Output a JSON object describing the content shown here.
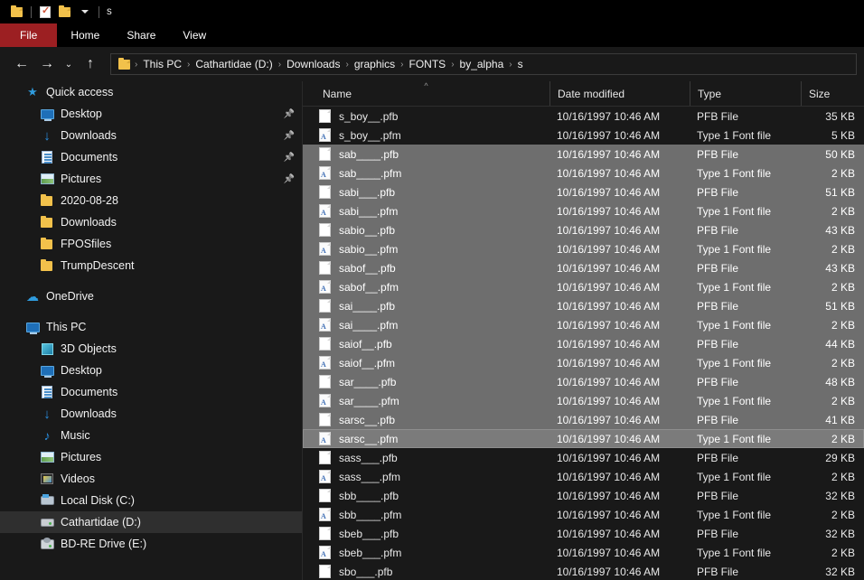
{
  "window": {
    "title": "s",
    "quick_access_toolbar": [
      {
        "name": "folder-icon",
        "label": "Explorer"
      },
      {
        "name": "properties-icon",
        "label": "Properties"
      },
      {
        "name": "new-folder-icon",
        "label": "New folder"
      },
      {
        "name": "customize-caret-icon",
        "label": "Customize Quick Access Toolbar"
      }
    ]
  },
  "ribbon": {
    "tabs": [
      {
        "label": "File",
        "active": true
      },
      {
        "label": "Home",
        "active": false
      },
      {
        "label": "Share",
        "active": false
      },
      {
        "label": "View",
        "active": false
      }
    ]
  },
  "addressbar": {
    "back_icon": "←",
    "forward_icon": "→",
    "recent_icon": "⌄",
    "up_icon": "↑",
    "separator": "›",
    "crumbs": [
      "This PC",
      "Cathartidae (D:)",
      "Downloads",
      "graphics",
      "FONTS",
      "by_alpha",
      "s"
    ]
  },
  "sidebar": {
    "items": [
      {
        "label": "Quick access",
        "icon": "star-icon",
        "indent": 0,
        "pinned": false,
        "selected": false
      },
      {
        "label": "Desktop",
        "icon": "desktop-icon",
        "indent": 1,
        "pinned": true,
        "selected": false
      },
      {
        "label": "Downloads",
        "icon": "downloads-icon",
        "indent": 1,
        "pinned": true,
        "selected": false
      },
      {
        "label": "Documents",
        "icon": "documents-icon",
        "indent": 1,
        "pinned": true,
        "selected": false
      },
      {
        "label": "Pictures",
        "icon": "pictures-icon",
        "indent": 1,
        "pinned": true,
        "selected": false
      },
      {
        "label": "2020-08-28",
        "icon": "folder-icon",
        "indent": 1,
        "pinned": false,
        "selected": false
      },
      {
        "label": "Downloads",
        "icon": "folder-icon",
        "indent": 1,
        "pinned": false,
        "selected": false
      },
      {
        "label": "FPOSfiles",
        "icon": "folder-icon",
        "indent": 1,
        "pinned": false,
        "selected": false
      },
      {
        "label": "TrumpDescent",
        "icon": "folder-icon",
        "indent": 1,
        "pinned": false,
        "selected": false
      },
      {
        "label": "OneDrive",
        "icon": "cloud-icon",
        "indent": 0,
        "pinned": false,
        "selected": false,
        "gap_before": true
      },
      {
        "label": "This PC",
        "icon": "pc-icon",
        "indent": 0,
        "pinned": false,
        "selected": false,
        "gap_before": true
      },
      {
        "label": "3D Objects",
        "icon": "3d-objects-icon",
        "indent": 1,
        "pinned": false,
        "selected": false
      },
      {
        "label": "Desktop",
        "icon": "desktop-icon",
        "indent": 1,
        "pinned": false,
        "selected": false
      },
      {
        "label": "Documents",
        "icon": "documents-icon",
        "indent": 1,
        "pinned": false,
        "selected": false
      },
      {
        "label": "Downloads",
        "icon": "downloads-icon",
        "indent": 1,
        "pinned": false,
        "selected": false
      },
      {
        "label": "Music",
        "icon": "music-icon",
        "indent": 1,
        "pinned": false,
        "selected": false
      },
      {
        "label": "Pictures",
        "icon": "pictures-icon",
        "indent": 1,
        "pinned": false,
        "selected": false
      },
      {
        "label": "Videos",
        "icon": "videos-icon",
        "indent": 1,
        "pinned": false,
        "selected": false
      },
      {
        "label": "Local Disk (C:)",
        "icon": "local-disk-icon",
        "indent": 1,
        "pinned": false,
        "selected": false
      },
      {
        "label": "Cathartidae (D:)",
        "icon": "drive-icon",
        "indent": 1,
        "pinned": false,
        "selected": true
      },
      {
        "label": "BD-RE Drive (E:)",
        "icon": "bd-drive-icon",
        "indent": 1,
        "pinned": false,
        "selected": false
      }
    ]
  },
  "filelist": {
    "columns": [
      {
        "label": "Name",
        "sorted": true,
        "sort_direction": "ascending",
        "sort_glyph": "^"
      },
      {
        "label": "Date modified",
        "sorted": false
      },
      {
        "label": "Type",
        "sorted": false
      },
      {
        "label": "Size",
        "sorted": false
      }
    ],
    "rows": [
      {
        "name": "s_boy__.pfb",
        "date": "10/16/1997 10:46 AM",
        "type": "PFB File",
        "size": "35 KB",
        "icon": "pfb-file-icon",
        "selected": false,
        "focused": false
      },
      {
        "name": "s_boy__.pfm",
        "date": "10/16/1997 10:46 AM",
        "type": "Type 1 Font file",
        "size": "5 KB",
        "icon": "pfm-file-icon",
        "selected": false,
        "focused": false
      },
      {
        "name": "sab____.pfb",
        "date": "10/16/1997 10:46 AM",
        "type": "PFB File",
        "size": "50 KB",
        "icon": "pfb-file-icon",
        "selected": true,
        "focused": false
      },
      {
        "name": "sab____.pfm",
        "date": "10/16/1997 10:46 AM",
        "type": "Type 1 Font file",
        "size": "2 KB",
        "icon": "pfm-file-icon",
        "selected": true,
        "focused": false
      },
      {
        "name": "sabi___.pfb",
        "date": "10/16/1997 10:46 AM",
        "type": "PFB File",
        "size": "51 KB",
        "icon": "pfb-file-icon",
        "selected": true,
        "focused": false
      },
      {
        "name": "sabi___.pfm",
        "date": "10/16/1997 10:46 AM",
        "type": "Type 1 Font file",
        "size": "2 KB",
        "icon": "pfm-file-icon",
        "selected": true,
        "focused": false
      },
      {
        "name": "sabio__.pfb",
        "date": "10/16/1997 10:46 AM",
        "type": "PFB File",
        "size": "43 KB",
        "icon": "pfb-file-icon",
        "selected": true,
        "focused": false
      },
      {
        "name": "sabio__.pfm",
        "date": "10/16/1997 10:46 AM",
        "type": "Type 1 Font file",
        "size": "2 KB",
        "icon": "pfm-file-icon",
        "selected": true,
        "focused": false
      },
      {
        "name": "sabof__.pfb",
        "date": "10/16/1997 10:46 AM",
        "type": "PFB File",
        "size": "43 KB",
        "icon": "pfb-file-icon",
        "selected": true,
        "focused": false
      },
      {
        "name": "sabof__.pfm",
        "date": "10/16/1997 10:46 AM",
        "type": "Type 1 Font file",
        "size": "2 KB",
        "icon": "pfm-file-icon",
        "selected": true,
        "focused": false
      },
      {
        "name": "sai____.pfb",
        "date": "10/16/1997 10:46 AM",
        "type": "PFB File",
        "size": "51 KB",
        "icon": "pfb-file-icon",
        "selected": true,
        "focused": false
      },
      {
        "name": "sai____.pfm",
        "date": "10/16/1997 10:46 AM",
        "type": "Type 1 Font file",
        "size": "2 KB",
        "icon": "pfm-file-icon",
        "selected": true,
        "focused": false
      },
      {
        "name": "saiof__.pfb",
        "date": "10/16/1997 10:46 AM",
        "type": "PFB File",
        "size": "44 KB",
        "icon": "pfb-file-icon",
        "selected": true,
        "focused": false
      },
      {
        "name": "saiof__.pfm",
        "date": "10/16/1997 10:46 AM",
        "type": "Type 1 Font file",
        "size": "2 KB",
        "icon": "pfm-file-icon",
        "selected": true,
        "focused": false
      },
      {
        "name": "sar____.pfb",
        "date": "10/16/1997 10:46 AM",
        "type": "PFB File",
        "size": "48 KB",
        "icon": "pfb-file-icon",
        "selected": true,
        "focused": false
      },
      {
        "name": "sar____.pfm",
        "date": "10/16/1997 10:46 AM",
        "type": "Type 1 Font file",
        "size": "2 KB",
        "icon": "pfm-file-icon",
        "selected": true,
        "focused": false
      },
      {
        "name": "sarsc__.pfb",
        "date": "10/16/1997 10:46 AM",
        "type": "PFB File",
        "size": "41 KB",
        "icon": "pfb-file-icon",
        "selected": true,
        "focused": false
      },
      {
        "name": "sarsc__.pfm",
        "date": "10/16/1997 10:46 AM",
        "type": "Type 1 Font file",
        "size": "2 KB",
        "icon": "pfm-file-icon",
        "selected": true,
        "focused": true
      },
      {
        "name": "sass___.pfb",
        "date": "10/16/1997 10:46 AM",
        "type": "PFB File",
        "size": "29 KB",
        "icon": "pfb-file-icon",
        "selected": false,
        "focused": false
      },
      {
        "name": "sass___.pfm",
        "date": "10/16/1997 10:46 AM",
        "type": "Type 1 Font file",
        "size": "2 KB",
        "icon": "pfm-file-icon",
        "selected": false,
        "focused": false
      },
      {
        "name": "sbb____.pfb",
        "date": "10/16/1997 10:46 AM",
        "type": "PFB File",
        "size": "32 KB",
        "icon": "pfb-file-icon",
        "selected": false,
        "focused": false
      },
      {
        "name": "sbb____.pfm",
        "date": "10/16/1997 10:46 AM",
        "type": "Type 1 Font file",
        "size": "2 KB",
        "icon": "pfm-file-icon",
        "selected": false,
        "focused": false
      },
      {
        "name": "sbeb___.pfb",
        "date": "10/16/1997 10:46 AM",
        "type": "PFB File",
        "size": "32 KB",
        "icon": "pfb-file-icon",
        "selected": false,
        "focused": false
      },
      {
        "name": "sbeb___.pfm",
        "date": "10/16/1997 10:46 AM",
        "type": "Type 1 Font file",
        "size": "2 KB",
        "icon": "pfm-file-icon",
        "selected": false,
        "focused": false
      },
      {
        "name": "sbo___.pfb",
        "date": "10/16/1997 10:46 AM",
        "type": "PFB File",
        "size": "32 KB",
        "icon": "pfb-file-icon",
        "selected": false,
        "focused": false
      }
    ]
  },
  "colors": {
    "window_bg": "#191919",
    "titlebar_bg": "#000000",
    "file_tab_bg": "#9c1f22",
    "selection_bg": "#6e6e6e",
    "sidebar_selection_bg": "#2f2f2f",
    "folder_yellow": "#f2c14b",
    "accent_blue": "#2a8fe0"
  }
}
